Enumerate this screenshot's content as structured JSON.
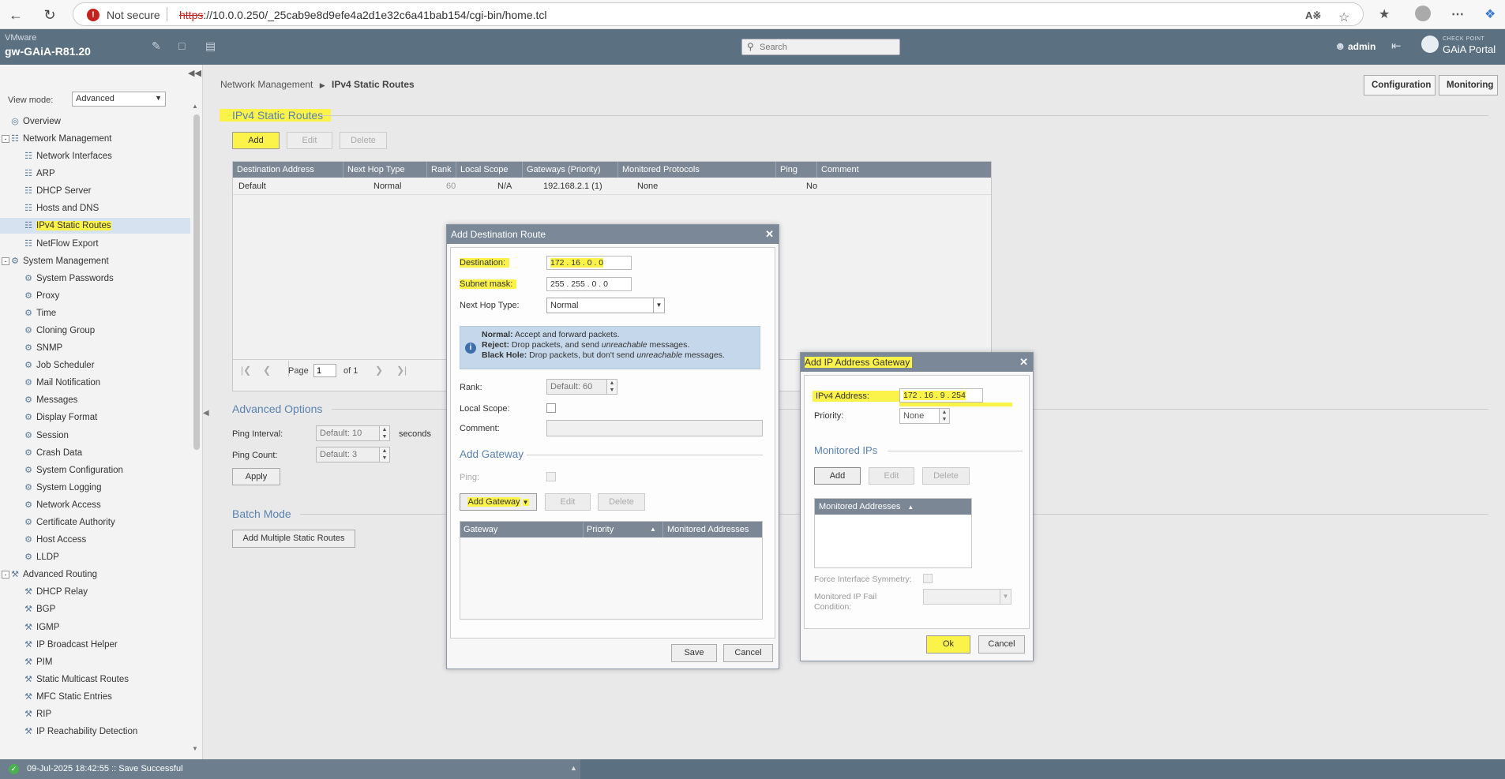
{
  "browser": {
    "not_secure": "Not secure",
    "url_scheme": "https",
    "url_rest": "://10.0.0.250/_25cab9e8d9efe4a2d1e32c6a41bab154/cgi-bin/home.tcl"
  },
  "header": {
    "vendor": "VMware",
    "hostname": "gw-GAiA-R81.20",
    "search_placeholder": "Search",
    "user": "admin",
    "brand_small": "CHECK POINT",
    "brand": "GAiA Portal"
  },
  "sidebar": {
    "view_mode_label": "View mode:",
    "view_mode_value": "Advanced",
    "items": [
      {
        "label": "Overview",
        "level": 0,
        "icon": "overview-icon"
      },
      {
        "label": "Network Management",
        "level": 0,
        "icon": "network-icon",
        "toggle": "-"
      },
      {
        "label": "Network Interfaces",
        "level": 1,
        "icon": "network-icon"
      },
      {
        "label": "ARP",
        "level": 1,
        "icon": "network-icon"
      },
      {
        "label": "DHCP Server",
        "level": 1,
        "icon": "network-icon"
      },
      {
        "label": "Hosts and DNS",
        "level": 1,
        "icon": "network-icon"
      },
      {
        "label": "IPv4 Static Routes",
        "level": 1,
        "icon": "network-icon",
        "selected": true
      },
      {
        "label": "NetFlow Export",
        "level": 1,
        "icon": "network-icon"
      },
      {
        "label": "System Management",
        "level": 0,
        "icon": "gear-icon",
        "toggle": "-"
      },
      {
        "label": "System Passwords",
        "level": 1,
        "icon": "gear-icon"
      },
      {
        "label": "Proxy",
        "level": 1,
        "icon": "gear-icon"
      },
      {
        "label": "Time",
        "level": 1,
        "icon": "gear-icon"
      },
      {
        "label": "Cloning Group",
        "level": 1,
        "icon": "gear-icon"
      },
      {
        "label": "SNMP",
        "level": 1,
        "icon": "gear-icon"
      },
      {
        "label": "Job Scheduler",
        "level": 1,
        "icon": "gear-icon"
      },
      {
        "label": "Mail Notification",
        "level": 1,
        "icon": "gear-icon"
      },
      {
        "label": "Messages",
        "level": 1,
        "icon": "gear-icon"
      },
      {
        "label": "Display Format",
        "level": 1,
        "icon": "gear-icon"
      },
      {
        "label": "Session",
        "level": 1,
        "icon": "gear-icon"
      },
      {
        "label": "Crash Data",
        "level": 1,
        "icon": "gear-icon"
      },
      {
        "label": "System Configuration",
        "level": 1,
        "icon": "gear-icon"
      },
      {
        "label": "System Logging",
        "level": 1,
        "icon": "gear-icon"
      },
      {
        "label": "Network Access",
        "level": 1,
        "icon": "gear-icon"
      },
      {
        "label": "Certificate Authority",
        "level": 1,
        "icon": "gear-icon"
      },
      {
        "label": "Host Access",
        "level": 1,
        "icon": "gear-icon"
      },
      {
        "label": "LLDP",
        "level": 1,
        "icon": "gear-icon"
      },
      {
        "label": "Advanced Routing",
        "level": 0,
        "icon": "routing-icon",
        "toggle": "-"
      },
      {
        "label": "DHCP Relay",
        "level": 1,
        "icon": "routing-icon"
      },
      {
        "label": "BGP",
        "level": 1,
        "icon": "routing-icon"
      },
      {
        "label": "IGMP",
        "level": 1,
        "icon": "routing-icon"
      },
      {
        "label": "IP Broadcast Helper",
        "level": 1,
        "icon": "routing-icon"
      },
      {
        "label": "PIM",
        "level": 1,
        "icon": "routing-icon"
      },
      {
        "label": "Static Multicast Routes",
        "level": 1,
        "icon": "routing-icon"
      },
      {
        "label": "MFC Static Entries",
        "level": 1,
        "icon": "routing-icon"
      },
      {
        "label": "RIP",
        "level": 1,
        "icon": "routing-icon"
      },
      {
        "label": "IP Reachability Detection",
        "level": 1,
        "icon": "routing-icon"
      }
    ]
  },
  "main": {
    "breadcrumb_parent": "Network Management",
    "breadcrumb_current": "IPv4 Static Routes",
    "configuration_tab": "Configuration",
    "monitoring_tab": "Monitoring",
    "section_title": "IPv4 Static Routes",
    "add": "Add",
    "edit": "Edit",
    "delete": "Delete",
    "table": {
      "columns": [
        "Destination Address",
        "Next Hop Type",
        "Rank",
        "Local Scope",
        "Gateways (Priority)",
        "Monitored Protocols",
        "Ping",
        "Comment"
      ],
      "rows": [
        [
          "Default",
          "Normal",
          "60",
          "N/A",
          "192.168.2.1 (1)",
          "None",
          "No",
          ""
        ]
      ]
    },
    "pager": {
      "page_label": "Page",
      "page_value": "1",
      "of_label": "of 1"
    },
    "advanced_title": "Advanced Options",
    "ping_interval_label": "Ping Interval:",
    "ping_interval_placeholder": "Default: 10",
    "seconds": "seconds",
    "ping_count_label": "Ping Count:",
    "ping_count_placeholder": "Default: 3",
    "apply": "Apply",
    "batch_title": "Batch Mode",
    "add_multiple": "Add Multiple Static Routes"
  },
  "dest_dialog": {
    "title": "Add Destination Route",
    "destination_label": "Destination:",
    "destination_value": "172 . 16 . 0 . 0",
    "subnet_label": "Subnet mask:",
    "subnet_value": "255 . 255 . 0 . 0",
    "next_hop_label": "Next Hop Type:",
    "next_hop_value": "Normal",
    "info_normal_b": "Normal:",
    "info_normal": " Accept and forward packets.",
    "info_reject_b": "Reject:",
    "info_reject_a": " Drop packets, and send ",
    "info_reject_i": "unreachable",
    "info_reject_c": " messages.",
    "info_bh_b": "Black Hole:",
    "info_bh_a": " Drop packets, but don't send ",
    "info_bh_i": "unreachable",
    "info_bh_c": " messages.",
    "rank_label": "Rank:",
    "rank_placeholder": "Default: 60",
    "local_scope_label": "Local Scope:",
    "comment_label": "Comment:",
    "add_gateway_title": "Add Gateway",
    "ping_label": "Ping:",
    "add_gateway_btn": "Add Gateway",
    "edit": "Edit",
    "delete": "Delete",
    "gw_columns": [
      "Gateway",
      "Priority",
      "Monitored Addresses"
    ],
    "save": "Save",
    "cancel": "Cancel"
  },
  "gw_dialog": {
    "title": "Add IP Address Gateway",
    "ipv4_label": "IPv4 Address:",
    "ipv4_value": "172 . 16 . 9 . 254",
    "priority_label": "Priority:",
    "priority_value": "None",
    "monitored_ips_title": "Monitored IPs",
    "add": "Add",
    "edit": "Edit",
    "delete": "Delete",
    "monitored_col": "Monitored Addresses",
    "force_symmetry": "Force Interface Symmetry:",
    "fail_condition_1": "Monitored IP Fail",
    "fail_condition_2": "Condition:",
    "ok": "Ok",
    "cancel": "Cancel"
  },
  "status": {
    "text": "09-Jul-2025 18:42:55 :: Save Successful"
  },
  "colors": {
    "header_bg": "#5b7081",
    "accent_blue": "#5a82b0",
    "highlight": "#fbf24a"
  }
}
